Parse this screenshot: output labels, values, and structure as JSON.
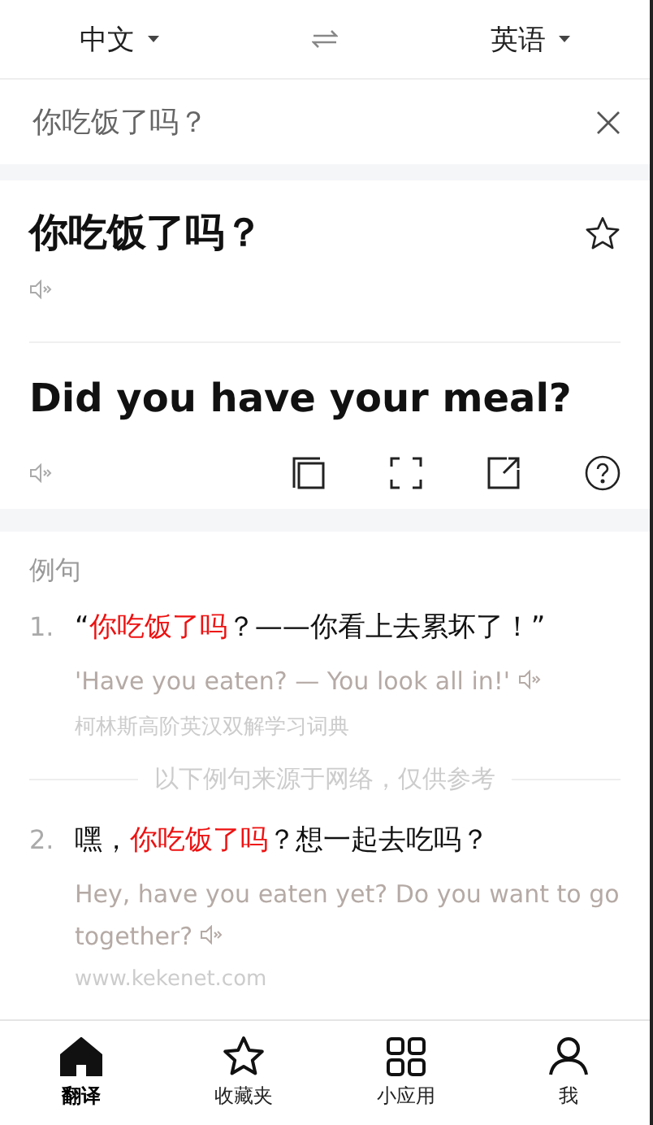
{
  "language_bar": {
    "source": "中文",
    "target": "英语"
  },
  "input": {
    "value": "你吃饭了吗？"
  },
  "result": {
    "source_text": "你吃饭了吗？",
    "favorited": false,
    "translation": "Did you have your meal?"
  },
  "examples": {
    "title": "例句",
    "items": [
      {
        "number": "1.",
        "segments": [
          {
            "text": "“",
            "highlight": false
          },
          {
            "text": "你吃饭了吗",
            "highlight": true
          },
          {
            "text": "？——你看上去累坏了！”",
            "highlight": false
          }
        ],
        "translation": "'Have you eaten? — You look all in!'",
        "source": "柯林斯高阶英汉双解学习词典"
      },
      {
        "number": "2.",
        "segments": [
          {
            "text": "嘿，",
            "highlight": false
          },
          {
            "text": "你吃饭了吗",
            "highlight": true
          },
          {
            "text": "？想一起去吃吗？",
            "highlight": false
          }
        ],
        "translation": "Hey, have you eaten yet? Do you want to go together?",
        "source": "www.kekenet.com"
      }
    ],
    "divider_note": "以下例句来源于网络，仅供参考"
  },
  "nav": [
    {
      "label": "翻译",
      "selected": true
    },
    {
      "label": "收藏夹",
      "selected": false
    },
    {
      "label": "小应用",
      "selected": false
    },
    {
      "label": "我",
      "selected": false
    }
  ]
}
